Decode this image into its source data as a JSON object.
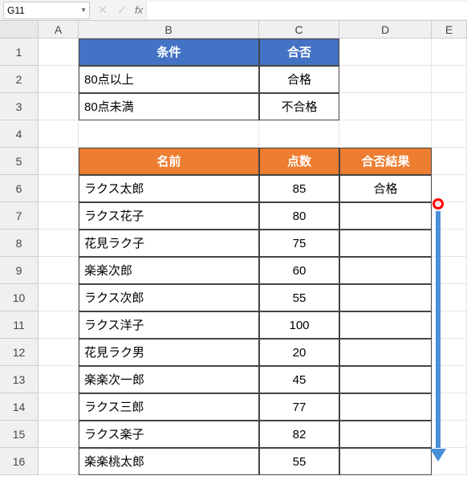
{
  "name_box": "G11",
  "fx_label": "fx",
  "columns": [
    "A",
    "B",
    "C",
    "D",
    "E"
  ],
  "conditions_table": {
    "header": {
      "b": "条件",
      "c": "合否"
    },
    "rows": [
      {
        "b": "80点以上",
        "c": "合格"
      },
      {
        "b": "80点未満",
        "c": "不合格"
      }
    ]
  },
  "results_table": {
    "header": {
      "b": "名前",
      "c": "点数",
      "d": "合否結果"
    },
    "rows": [
      {
        "b": "ラクス太郎",
        "c": "85",
        "d": "合格"
      },
      {
        "b": "ラクス花子",
        "c": "80",
        "d": ""
      },
      {
        "b": "花見ラク子",
        "c": "75",
        "d": ""
      },
      {
        "b": "楽楽次郎",
        "c": "60",
        "d": ""
      },
      {
        "b": "ラクス次郎",
        "c": "55",
        "d": ""
      },
      {
        "b": "ラクス洋子",
        "c": "100",
        "d": ""
      },
      {
        "b": "花見ラク男",
        "c": "20",
        "d": ""
      },
      {
        "b": "楽楽次一郎",
        "c": "45",
        "d": ""
      },
      {
        "b": "ラクス三郎",
        "c": "77",
        "d": ""
      },
      {
        "b": "ラクス楽子",
        "c": "82",
        "d": ""
      },
      {
        "b": "楽楽桃太郎",
        "c": "55",
        "d": ""
      }
    ]
  },
  "row_numbers": [
    "1",
    "2",
    "3",
    "4",
    "5",
    "6",
    "7",
    "8",
    "9",
    "10",
    "11",
    "12",
    "13",
    "14",
    "15",
    "16"
  ]
}
